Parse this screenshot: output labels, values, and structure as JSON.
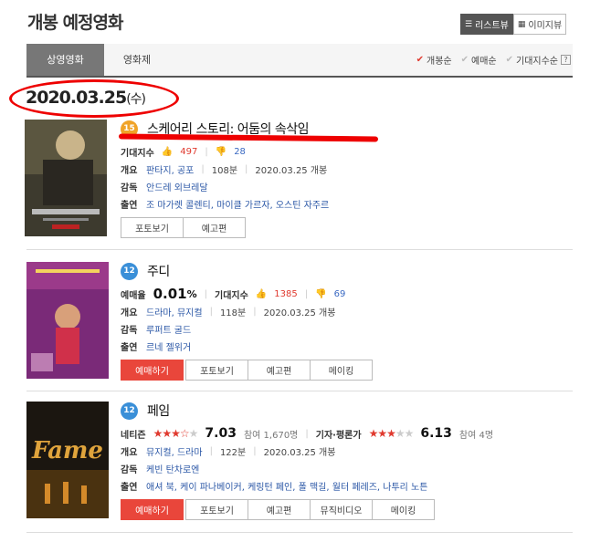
{
  "page": {
    "title": "개봉 예정영화"
  },
  "view_toggle": {
    "list": "리스트뷰",
    "image": "이미지뷰"
  },
  "tabs": {
    "active": "상영영화",
    "other": "영화제"
  },
  "sorts": {
    "release": "개봉순",
    "reserve": "예매순",
    "expect": "기대지수순",
    "help": "?"
  },
  "date": {
    "value": "2020.03.25",
    "day": "(수)"
  },
  "movies": [
    {
      "age": "15",
      "title": "스케어리 스토리: 어둠의 속삭임",
      "expect_label": "기대지수",
      "up": "497",
      "down": "28",
      "overview_label": "개요",
      "genres": "판타지, 공포",
      "runtime": "108분",
      "release": "2020.03.25 개봉",
      "director_label": "감독",
      "director": "안드레 외브레달",
      "cast_label": "출연",
      "cast": "조 마가렛 콜렌티, 마이클 가르자, 오스틴 자주르",
      "buttons": [
        "포토보기",
        "예고편"
      ]
    },
    {
      "age": "12",
      "title": "주디",
      "reserve_label": "예매율",
      "reserve_rate": "0.01",
      "reserve_unit": "%",
      "expect_label": "기대지수",
      "up": "1385",
      "down": "69",
      "overview_label": "개요",
      "genres": "드라마, 뮤지컬",
      "runtime": "118분",
      "release": "2020.03.25 개봉",
      "director_label": "감독",
      "director": "루퍼트 굴드",
      "cast_label": "출연",
      "cast": "르네 젤위거",
      "book": "예매하기",
      "buttons": [
        "포토보기",
        "예고편",
        "메이킹"
      ]
    },
    {
      "age": "12",
      "title": "페임",
      "netizen_label": "네티즌",
      "netizen_score": "7.03",
      "netizen_rating": 3.5,
      "netizen_count": "참여 1,670명",
      "critic_label": "기자·평론가",
      "critic_score": "6.13",
      "critic_rating": 3,
      "critic_count": "참여 4명",
      "overview_label": "개요",
      "genres": "뮤지컬, 드라마",
      "runtime": "122분",
      "release": "2020.03.25 개봉",
      "director_label": "감독",
      "director": "케빈 탄차로엔",
      "cast_label": "출연",
      "cast": "애셔 북, 케이 파나베이커, 케링턴 페인, 폴 맥길, 월터 페레즈, 나투리 노튼",
      "book": "예매하기",
      "buttons": [
        "포토보기",
        "예고편",
        "뮤직비디오",
        "메이킹"
      ],
      "poster_text": "Fame"
    }
  ],
  "colors": {
    "accent": "#e03a2f",
    "link": "#2b57a6",
    "age15": "#f0a327",
    "age12": "#3a8fd8"
  }
}
